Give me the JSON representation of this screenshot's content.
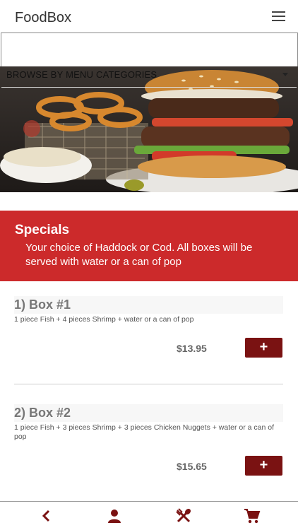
{
  "app": {
    "title": "FoodBox"
  },
  "header": {
    "menu_icon": "hamburger-menu-icon"
  },
  "search": {
    "value": ""
  },
  "categories": {
    "selected": "BROWSE BY MENU CATEGORIES"
  },
  "specials": {
    "title": "Specials",
    "description": "Your choice of Haddock or Cod. All boxes will be served with water or a can of pop"
  },
  "items": [
    {
      "title": "1)  Box #1",
      "description": "1 piece Fish + 4 pieces Shrimp + water or a can of pop",
      "price": "$13.95",
      "add_label": "+"
    },
    {
      "title": "2)  Box #2",
      "description": "1 piece Fish + 3 pieces Shrimp + 3 pieces Chicken Nuggets + water or a can of pop",
      "price": "$15.65",
      "add_label": "+"
    }
  ],
  "bottom_nav": {
    "icons": [
      "back-chevron-icon",
      "user-icon",
      "fork-spoon-icon",
      "cart-icon"
    ]
  },
  "colors": {
    "specials_bg": "#cc2a2b",
    "accent": "#7a1212"
  }
}
